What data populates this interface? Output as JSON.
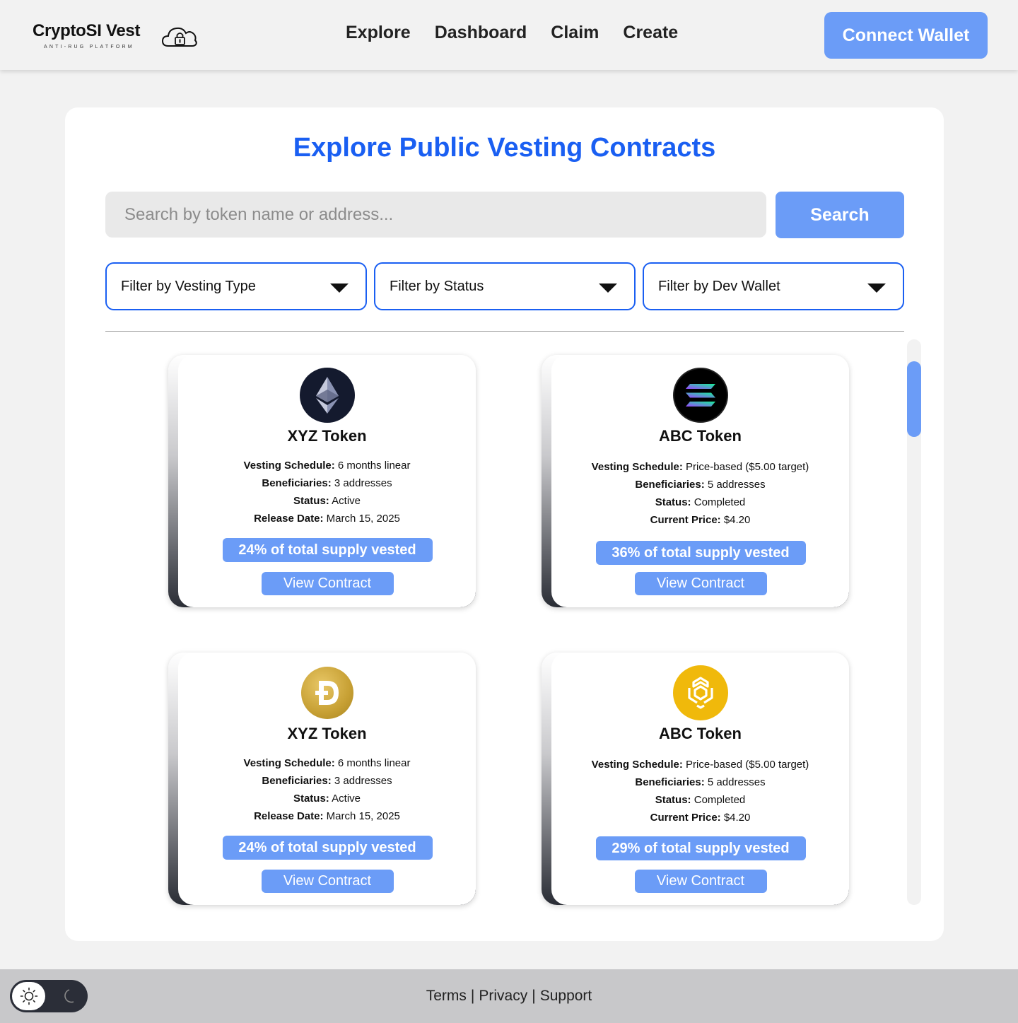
{
  "header": {
    "logo_title": "CryptoSI Vest",
    "logo_subtitle": "ANTI-RUG PLATFORM",
    "nav": [
      {
        "label": "Explore"
      },
      {
        "label": "Dashboard"
      },
      {
        "label": "Claim"
      },
      {
        "label": "Create"
      }
    ],
    "connect_label": "Connect Wallet"
  },
  "main": {
    "title": "Explore Public Vesting Contracts",
    "search": {
      "placeholder": "Search by token name or address...",
      "value": "",
      "button_label": "Search"
    },
    "filters": [
      {
        "label": "Filter by Vesting Type"
      },
      {
        "label": "Filter by Status"
      },
      {
        "label": "Filter by Dev Wallet"
      }
    ],
    "tokens": [
      {
        "icon": "ethereum-icon",
        "name": "XYZ Token",
        "rows": [
          {
            "label": "Vesting Schedule:",
            "value": "6 months linear"
          },
          {
            "label": "Beneficiaries:",
            "value": "3 addresses"
          },
          {
            "label": "Status:",
            "value": "Active"
          },
          {
            "label": "Release Date:",
            "value": "March 15, 2025"
          }
        ],
        "supply": "24% of total supply vested",
        "button_label": "View Contract"
      },
      {
        "icon": "solana-icon",
        "name": "ABC Token",
        "rows": [
          {
            "label": "Vesting Schedule:",
            "value": "Price-based ($5.00 target)"
          },
          {
            "label": "Beneficiaries:",
            "value": "5 addresses"
          },
          {
            "label": "Status:",
            "value": "Completed"
          },
          {
            "label": "Current Price:",
            "value": "$4.20"
          }
        ],
        "supply": "36% of total supply vested",
        "button_label": "View Contract"
      },
      {
        "icon": "dogecoin-icon",
        "name": "XYZ Token",
        "rows": [
          {
            "label": "Vesting Schedule:",
            "value": "6 months linear"
          },
          {
            "label": "Beneficiaries:",
            "value": "3 addresses"
          },
          {
            "label": "Status:",
            "value": "Active"
          },
          {
            "label": "Release Date:",
            "value": "March 15, 2025"
          }
        ],
        "supply": "24% of total supply vested",
        "button_label": "View Contract"
      },
      {
        "icon": "bnb-icon",
        "name": "ABC Token",
        "rows": [
          {
            "label": "Vesting Schedule:",
            "value": "Price-based ($5.00 target)"
          },
          {
            "label": "Beneficiaries:",
            "value": "5 addresses"
          },
          {
            "label": "Status:",
            "value": "Completed"
          },
          {
            "label": "Current Price:",
            "value": "$4.20"
          }
        ],
        "supply": "29% of total supply vested",
        "button_label": "View Contract"
      }
    ]
  },
  "footer": {
    "links": [
      {
        "label": "Terms"
      },
      {
        "label": "Privacy"
      },
      {
        "label": "Support"
      }
    ],
    "separator": "|",
    "theme": "light"
  },
  "colors": {
    "accent": "#6b9cf7",
    "title_blue": "#1a5ff2",
    "background": "#f2f2f2",
    "footer": "#c8c8ca"
  }
}
